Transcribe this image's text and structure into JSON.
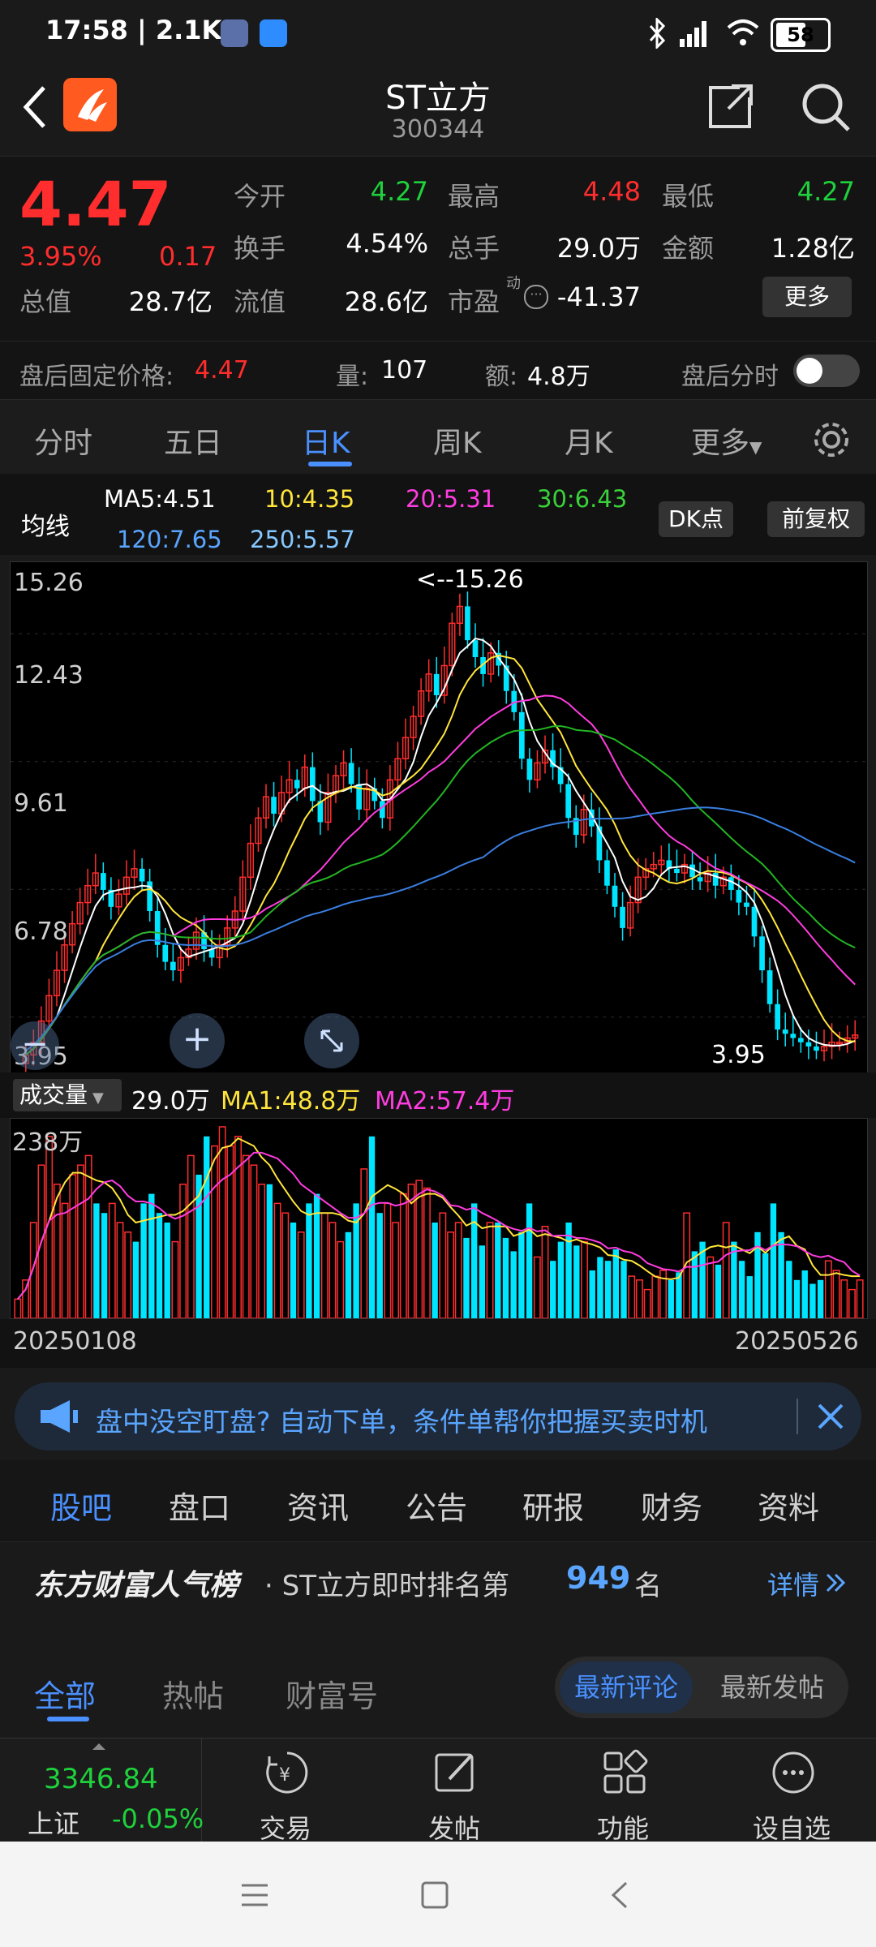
{
  "status": {
    "time_speed": "17:58 | 2.1K/s",
    "battery": "58"
  },
  "header": {
    "title": "ST立方",
    "code": "300344"
  },
  "quote": {
    "price": "4.47",
    "change_pct": "3.95%",
    "change": "0.17",
    "open_label": "今开",
    "open": "4.27",
    "high_label": "最高",
    "high": "4.48",
    "low_label": "最低",
    "low": "4.27",
    "turnover_label": "换手",
    "turnover": "4.54%",
    "volume_label": "总手",
    "volume": "29.0万",
    "amount_label": "金额",
    "amount": "1.28亿",
    "mktcap_label": "总值",
    "mktcap": "28.7亿",
    "float_label": "流值",
    "float": "28.6亿",
    "pe_label": "市盈",
    "pe_sup": "动",
    "pe": "-41.37",
    "more": "更多"
  },
  "afterhours": {
    "label": "盘后固定价格:",
    "price": "4.47",
    "vol_label": "量:",
    "vol": "107",
    "amt_label": "额:",
    "amt": "4.8万",
    "switch_label": "盘后分时"
  },
  "period_tabs": [
    "分时",
    "五日",
    "日K",
    "周K",
    "月K",
    "更多"
  ],
  "ma_legend": {
    "title": "均线",
    "ma5": "MA5:4.51",
    "ma10": "10:4.35",
    "ma20": "20:5.31",
    "ma30": "30:6.43",
    "ma120": "120:7.65",
    "ma250": "250:5.57",
    "dk": "DK点",
    "adjust": "前复权"
  },
  "chart_data": {
    "type": "candlestick",
    "y_ticks": [
      "15.26",
      "12.43",
      "9.61",
      "6.78",
      "3.95"
    ],
    "ylim": [
      3.95,
      15.26
    ],
    "max_annotation": "<--15.26",
    "min_annotation": "3.95",
    "x_start": "20250108",
    "x_end": "20250526",
    "colors": {
      "up": "#ff2d2d",
      "down": "#00e5ff",
      "ma5": "#ffffff",
      "ma10": "#ffe53b",
      "ma20": "#ff3ce0",
      "ma30": "#22b522",
      "ma120": "#3a7ee0",
      "ma250": "#86c8ff"
    },
    "closes": [
      4.0,
      4.3,
      4.8,
      5.4,
      6.0,
      6.6,
      7.1,
      7.6,
      8.0,
      8.3,
      7.9,
      7.5,
      7.8,
      8.2,
      8.4,
      8.1,
      7.4,
      6.6,
      6.2,
      6.0,
      6.3,
      6.5,
      6.9,
      6.5,
      6.3,
      6.6,
      7.0,
      7.4,
      8.2,
      9.0,
      9.6,
      10.1,
      9.7,
      10.2,
      10.5,
      10.3,
      10.8,
      10.0,
      9.5,
      10.2,
      10.6,
      10.9,
      10.4,
      9.8,
      10.3,
      10.0,
      9.6,
      10.5,
      11.0,
      11.5,
      12.0,
      12.6,
      13.0,
      12.5,
      13.2,
      14.2,
      14.6,
      13.8,
      13.4,
      13.0,
      13.5,
      13.2,
      12.6,
      12.1,
      11.0,
      10.5,
      10.9,
      11.2,
      10.8,
      10.4,
      9.6,
      9.2,
      9.8,
      9.4,
      8.6,
      8.0,
      7.5,
      7.0,
      7.6,
      8.2,
      8.4,
      8.5,
      8.6,
      8.4,
      8.3,
      8.5,
      8.2,
      8.1,
      8.3,
      8.0,
      8.2,
      7.9,
      7.6,
      7.5,
      6.8,
      6.0,
      5.2,
      4.6,
      4.5,
      4.4,
      4.3,
      4.2,
      4.1,
      4.2,
      4.3,
      4.3,
      4.4,
      4.47
    ],
    "volume_legend": {
      "label": "成交量",
      "value": "29.0万",
      "ma1": "MA1:48.8万",
      "ma2": "MA2:57.4万",
      "y_max": "238万"
    },
    "volumes": [
      0.1,
      0.2,
      0.5,
      0.8,
      0.95,
      0.7,
      0.6,
      0.75,
      0.8,
      0.85,
      0.6,
      0.55,
      0.6,
      0.5,
      0.45,
      0.4,
      0.6,
      0.65,
      0.55,
      0.5,
      0.4,
      0.7,
      0.85,
      0.75,
      0.95,
      0.9,
      1.0,
      0.9,
      0.95,
      0.85,
      0.8,
      0.7,
      0.7,
      0.6,
      0.55,
      0.5,
      0.45,
      0.6,
      0.65,
      0.55,
      0.5,
      0.4,
      0.45,
      0.6,
      0.78,
      0.95,
      0.55,
      0.6,
      0.5,
      0.65,
      0.7,
      0.72,
      0.68,
      0.5,
      0.55,
      0.45,
      0.5,
      0.42,
      0.6,
      0.38,
      0.5,
      0.5,
      0.42,
      0.35,
      0.45,
      0.6,
      0.32,
      0.48,
      0.3,
      0.4,
      0.5,
      0.38,
      0.4,
      0.25,
      0.32,
      0.3,
      0.36,
      0.3,
      0.22,
      0.2,
      0.15,
      0.22,
      0.25,
      0.2,
      0.24,
      0.55,
      0.35,
      0.4,
      0.32,
      0.28,
      0.5,
      0.4,
      0.3,
      0.22,
      0.45,
      0.34,
      0.6,
      0.45,
      0.3,
      0.2,
      0.25,
      0.18,
      0.2,
      0.3,
      0.25,
      0.2,
      0.15,
      0.2
    ]
  },
  "ad": {
    "text": "盘中没空盯盘? 自动下单，条件单帮你把握买卖时机"
  },
  "section_tabs": [
    "股吧",
    "盘口",
    "资讯",
    "公告",
    "研报",
    "财务",
    "资料"
  ],
  "rank": {
    "brand": "东方财富人气榜",
    "prefix": "· ST立方即时排名第",
    "number": "949",
    "suffix": "名",
    "details": "详情"
  },
  "forum_tabs": [
    "全部",
    "热帖",
    "财富号"
  ],
  "sort": {
    "latest_comment": "最新评论",
    "latest_post": "最新发帖"
  },
  "bottom_nav": {
    "index_value": "3346.84",
    "index_name": "上证",
    "index_change": "-0.05%",
    "trade": "交易",
    "post": "发帖",
    "function": "功能",
    "watch": "设自选"
  }
}
